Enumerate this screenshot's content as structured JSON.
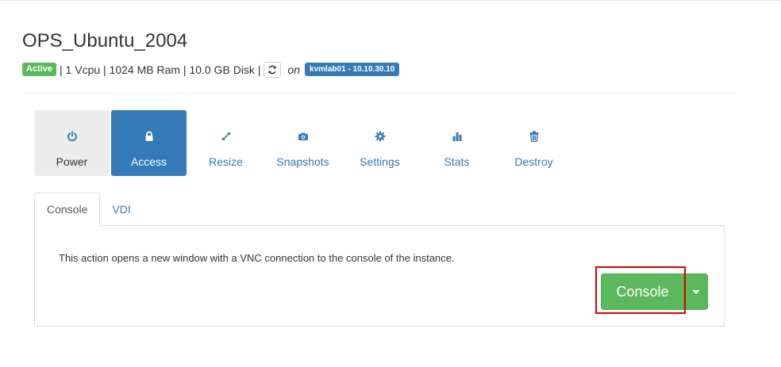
{
  "instance": {
    "title": "OPS_Ubuntu_2004",
    "status": "Active",
    "specs": "| 1 Vcpu | 1024 MB Ram | 10.0 GB Disk |",
    "on_label": "on",
    "host": "kvmlab01 - 10.10.30.10"
  },
  "actions": [
    {
      "label": "Power",
      "icon": "power-icon"
    },
    {
      "label": "Access",
      "icon": "lock-icon"
    },
    {
      "label": "Resize",
      "icon": "resize-icon"
    },
    {
      "label": "Snapshots",
      "icon": "camera-icon"
    },
    {
      "label": "Settings",
      "icon": "gear-icon"
    },
    {
      "label": "Stats",
      "icon": "bar-chart-icon"
    },
    {
      "label": "Destroy",
      "icon": "trash-icon"
    }
  ],
  "tabs": [
    {
      "label": "Console"
    },
    {
      "label": "VDI"
    }
  ],
  "console_panel": {
    "description": "This action opens a new window with a VNC connection to the console of the instance.",
    "button_label": "Console"
  },
  "colors": {
    "primary": "#337ab7",
    "success": "#5cb85c",
    "highlight": "#e00000"
  }
}
